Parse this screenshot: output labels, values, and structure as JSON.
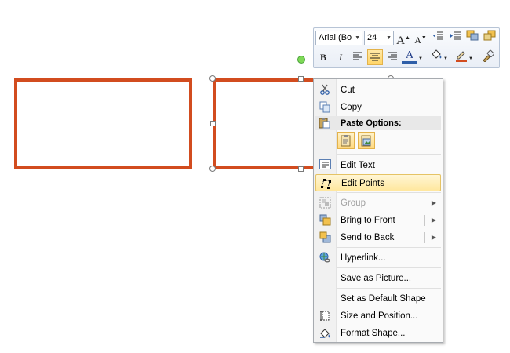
{
  "colors": {
    "shape_outline": "#d24c1f",
    "highlight": "#ffe79e",
    "accent_blue": "#2f5fa8"
  },
  "mini_toolbar": {
    "font_name": "Arial (Bo",
    "font_size": "24",
    "icons": [
      "grow-font-icon",
      "shrink-font-icon",
      "decrease-indent-icon",
      "increase-indent-icon",
      "shape-styles-icon",
      "arrange-icon",
      "bold-icon",
      "italic-icon",
      "align-left-icon",
      "align-center-icon",
      "align-right-icon",
      "font-color-icon",
      "shape-fill-icon",
      "shape-outline-icon",
      "format-painter-icon"
    ],
    "bold_label": "B",
    "italic_label": "I",
    "font_color_label": "A",
    "grow_label": "A",
    "shrink_label": "A"
  },
  "context_menu": {
    "items": [
      {
        "label": "Cut",
        "icon": "scissors-icon"
      },
      {
        "label": "Copy",
        "icon": "copy-icon"
      },
      {
        "label": "Paste Options:",
        "icon": "paste-icon"
      },
      {
        "label": "Edit Text",
        "icon": "edit-text-icon"
      },
      {
        "label": "Edit Points",
        "icon": "edit-points-icon",
        "highlighted": true
      },
      {
        "label": "Group",
        "icon": "group-icon",
        "disabled": true,
        "submenu": true
      },
      {
        "label": "Bring to Front",
        "icon": "bring-to-front-icon",
        "submenu": true
      },
      {
        "label": "Send to Back",
        "icon": "send-to-back-icon",
        "submenu": true
      },
      {
        "label": "Hyperlink...",
        "icon": "hyperlink-icon"
      },
      {
        "label": "Save as Picture...",
        "icon": ""
      },
      {
        "label": "Set as Default Shape",
        "icon": ""
      },
      {
        "label": "Size and Position...",
        "icon": "size-position-icon"
      },
      {
        "label": "Format Shape...",
        "icon": "format-shape-icon"
      }
    ],
    "paste_buttons": [
      "paste-keep-text-icon",
      "paste-picture-icon"
    ]
  }
}
